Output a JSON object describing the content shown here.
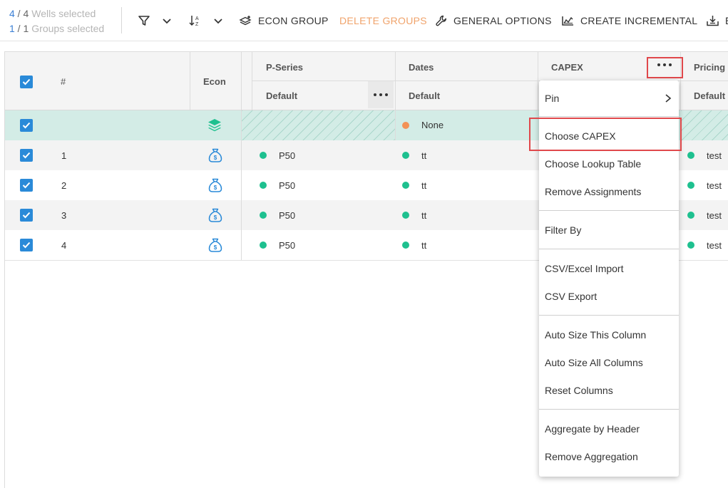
{
  "toolbar": {
    "wells_count": "4",
    "wells_total": "4",
    "wells_label": "Wells selected",
    "groups_count": "1",
    "groups_total": "1",
    "groups_label": "Groups selected",
    "econ_group_label": "ECON GROUP",
    "delete_groups_label": "DELETE GROUPS",
    "general_options_label": "GENERAL OPTIONS",
    "create_incremental_label": "CREATE INCREMENTAL",
    "truncated_label": "E",
    "delete_color": "#f0a36b"
  },
  "grid": {
    "columns": {
      "num": "#",
      "econ": "Econ",
      "pseries": "P-Series",
      "pseries_sub": "Default",
      "dates": "Dates",
      "dates_sub": "Default",
      "capex": "CAPEX",
      "pricing": "Pricing",
      "pricing_sub": "Default"
    },
    "group_row": {
      "dates": "None"
    },
    "rows": [
      {
        "num": "1",
        "pseries": "P50",
        "dates": "tt",
        "pricing": "test"
      },
      {
        "num": "2",
        "pseries": "P50",
        "dates": "tt",
        "pricing": "test"
      },
      {
        "num": "3",
        "pseries": "P50",
        "dates": "tt",
        "pricing": "test"
      },
      {
        "num": "4",
        "pseries": "P50",
        "dates": "tt",
        "pricing": "test"
      }
    ],
    "colors": {
      "checkbox": "#2a8ad8",
      "status_green": "#1ec08f",
      "status_orange": "#f39257",
      "selected_row": "#d3ece6"
    }
  },
  "context_menu": {
    "pin": "Pin",
    "choose_capex": "Choose CAPEX",
    "choose_lookup": "Choose Lookup Table",
    "remove_assignments": "Remove Assignments",
    "filter_by": "Filter By",
    "csv_import": "CSV/Excel Import",
    "csv_export": "CSV Export",
    "autosize_this": "Auto Size This Column",
    "autosize_all": "Auto Size All Columns",
    "reset_columns": "Reset Columns",
    "aggregate_header": "Aggregate by Header",
    "remove_aggregation": "Remove Aggregation"
  },
  "highlight_color": "#e0484b"
}
